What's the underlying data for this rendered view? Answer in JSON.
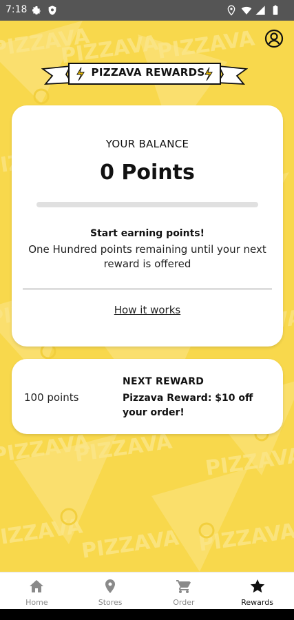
{
  "status_bar": {
    "time": "7:18"
  },
  "header": {
    "title": "PIZZAVA REWARDS"
  },
  "balance": {
    "label": "YOUR BALANCE",
    "points": "0 Points",
    "progress_fraction": 0,
    "earn_title": "Start earning points!",
    "earn_desc": "One Hundred points remaining until your next reward is offered",
    "how_link": "How it works"
  },
  "next_reward": {
    "points": "100 points",
    "label": "NEXT REWARD",
    "description": "Pizzava Reward: $10 off your order!"
  },
  "nav": {
    "items": [
      {
        "label": "Home",
        "icon": "home-icon",
        "active": false
      },
      {
        "label": "Stores",
        "icon": "location-pin-icon",
        "active": false
      },
      {
        "label": "Order",
        "icon": "cart-icon",
        "active": false
      },
      {
        "label": "Rewards",
        "icon": "star-icon",
        "active": true
      }
    ]
  },
  "colors": {
    "accent": "#f8d84c",
    "pattern": "#fbe68a",
    "text": "#111111",
    "inactive_nav": "#8a8a8a"
  },
  "background": {
    "pattern_word": "PIZZAVA"
  }
}
